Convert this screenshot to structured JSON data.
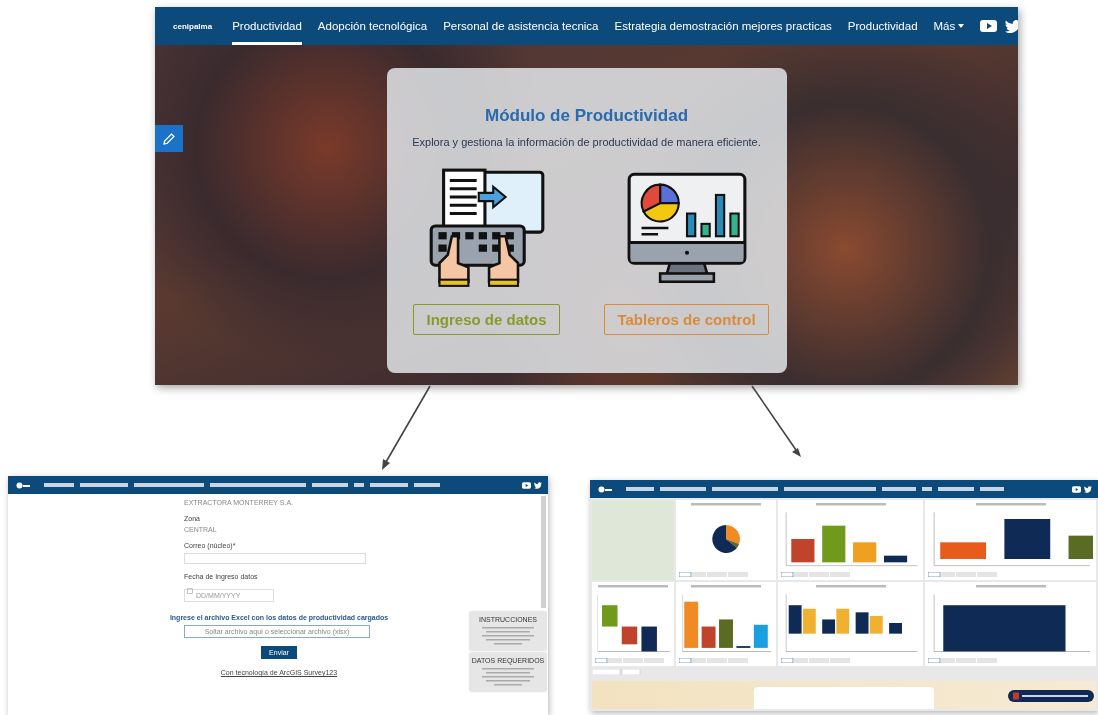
{
  "top_page": {
    "logo": "cenipalma",
    "nav": [
      {
        "label": "Productividad",
        "selected": true
      },
      {
        "label": "Adopción tecnológica",
        "selected": false
      },
      {
        "label": "Personal de asistencia tecnica",
        "selected": false
      },
      {
        "label": "Estrategia demostración mejores practicas",
        "selected": false
      },
      {
        "label": "Productividad",
        "selected": false
      }
    ],
    "more": "Más",
    "card": {
      "title": "Módulo de Productividad",
      "subtitle": "Explora y gestiona la información de productividad de manera eficiente.",
      "buttons": [
        {
          "label": "Ingreso de datos",
          "kind": "entry"
        },
        {
          "label": "Tableros de control",
          "kind": "dashboard"
        }
      ]
    }
  },
  "form_page": {
    "form": {
      "nucleo_value": "EXTRACTORA MONTERREY S.A.",
      "zone_label": "Zona",
      "zone_value": "CENTRAL",
      "email_label": "Correo (núcleo)*",
      "date_label": "Fecha de Ingreso datos",
      "date_placeholder": "DD/MM/YYYY",
      "upload_heading": "Ingrese el archivo Excel con los datos de productividad cargados",
      "upload_placeholder": "Soltar archivo aquí o seleccionar archivo (xlsx)",
      "submit": "Enviar",
      "footer_link": "Con tecnología de ArcGIS Survey123"
    },
    "side_panels": [
      {
        "title": "INSTRUCCIONES"
      },
      {
        "title": "DATOS REQUERIDOS"
      }
    ]
  }
}
